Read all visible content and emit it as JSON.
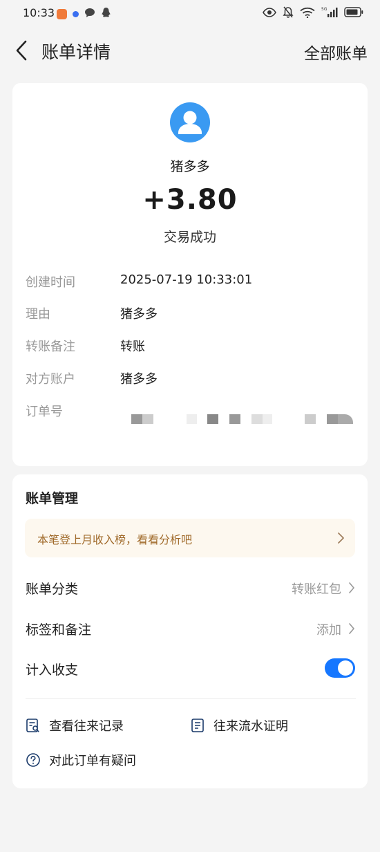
{
  "status_bar": {
    "time": "10:33"
  },
  "nav": {
    "title": "账单详情",
    "right_action": "全部账单"
  },
  "detail": {
    "payee": "猪多多",
    "amount": "+3.80",
    "status": "交易成功",
    "rows": [
      {
        "label": "创建时间",
        "value": "2025-07-19 10:33:01"
      },
      {
        "label": "理由",
        "value": "猪多多"
      },
      {
        "label": "转账备注",
        "value": "转账"
      },
      {
        "label": "对方账户",
        "value": "猪多多"
      },
      {
        "label": "订单号",
        "value": ""
      }
    ]
  },
  "manage": {
    "title": "账单管理",
    "banner": "本笔登上月收入榜，看看分析吧",
    "category_label": "账单分类",
    "category_value": "转账红包",
    "tags_label": "标签和备注",
    "tags_value": "添加",
    "include_label": "计入收支",
    "include_on": true,
    "links": {
      "history": "查看往来记录",
      "proof": "往来流水证明",
      "question": "对此订单有疑问"
    }
  },
  "colors": {
    "accent": "#1677ff",
    "avatar": "#3a9af2",
    "banner_text": "#a06a2a",
    "banner_bg": "#fdf8ef"
  }
}
